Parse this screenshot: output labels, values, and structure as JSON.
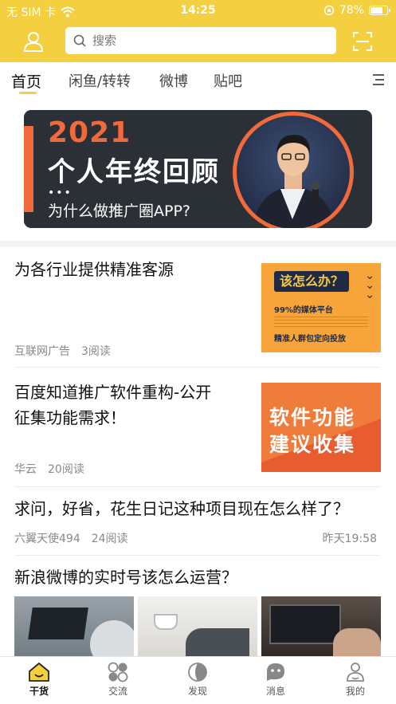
{
  "status_bar": {
    "carrier": "无 SIM 卡",
    "time": "14:25",
    "battery": "78%",
    "battery_level": 0.78
  },
  "search": {
    "placeholder": "搜索"
  },
  "tabs": [
    {
      "label": "首页",
      "active": true
    },
    {
      "label": "闲鱼/转转",
      "active": false
    },
    {
      "label": "微博",
      "active": false
    },
    {
      "label": "贴吧",
      "active": false
    }
  ],
  "banner": {
    "year": "2021",
    "title": "个人年终回顾",
    "dots": "•••",
    "subtitle": "为什么做推广圈APP?"
  },
  "articles": [
    {
      "title": "为各行业提供精准客源",
      "author": "互联网广告",
      "reads": "3阅读",
      "thumb": {
        "heading": "该怎么办？",
        "line1": "99%的媒体平台",
        "line2": "精准人群包定向投放"
      }
    },
    {
      "title_line1": "百度知道推广软件重构-公开",
      "title_line2": "征集功能需求！",
      "author": "华云",
      "reads": "20阅读",
      "thumb": {
        "line1": "软件功能",
        "line2": "建议收集"
      }
    },
    {
      "title": "求问，好省，花生日记这种项目现在怎么样了？",
      "author": "六翼天使494",
      "reads": "24阅读",
      "time": "昨天19:58"
    },
    {
      "title": "新浪微博的实时号该怎么运营？"
    }
  ],
  "bottom_nav": [
    {
      "label": "干货",
      "icon": "home-icon",
      "active": true
    },
    {
      "label": "交流",
      "icon": "chat-icon",
      "active": false
    },
    {
      "label": "发现",
      "icon": "compass-icon",
      "active": false
    },
    {
      "label": "消息",
      "icon": "message-icon",
      "active": false
    },
    {
      "label": "我的",
      "icon": "profile-icon",
      "active": false
    }
  ],
  "colors": {
    "brand_yellow": "#f4cf3f",
    "banner_dark": "#2b2f36",
    "banner_orange": "#f06a3b"
  }
}
